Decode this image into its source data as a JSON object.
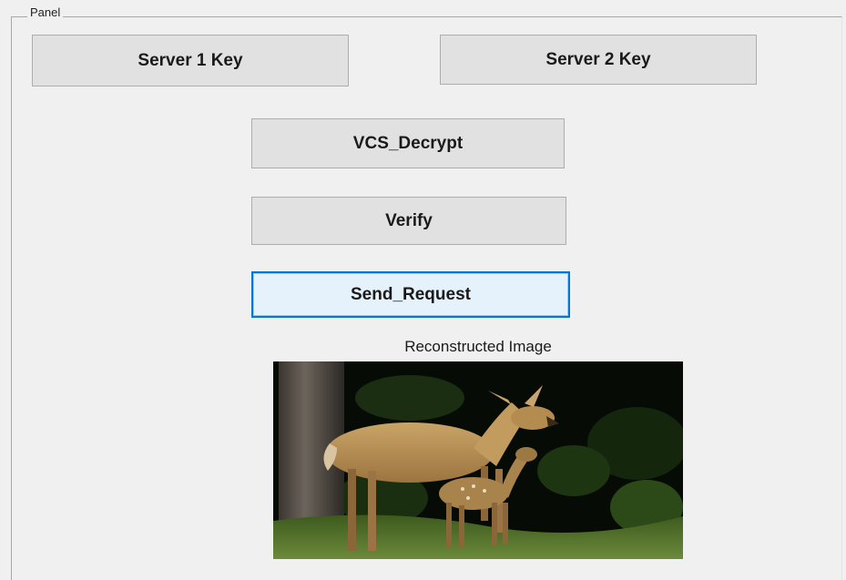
{
  "panel": {
    "title": "Panel"
  },
  "buttons": {
    "server1_key": "Server 1 Key",
    "server2_key": "Server 2 Key",
    "vcs_decrypt": "VCS_Decrypt",
    "verify": "Verify",
    "send_request": "Send_Request"
  },
  "image_section": {
    "title": "Reconstructed Image",
    "content_icon": "deer-photo"
  },
  "colors": {
    "window_bg": "#f0f0f0",
    "button_bg": "#e1e1e1",
    "button_border": "#adadad",
    "focus_border": "#0078d7",
    "focus_bg": "#e5f1fb"
  }
}
